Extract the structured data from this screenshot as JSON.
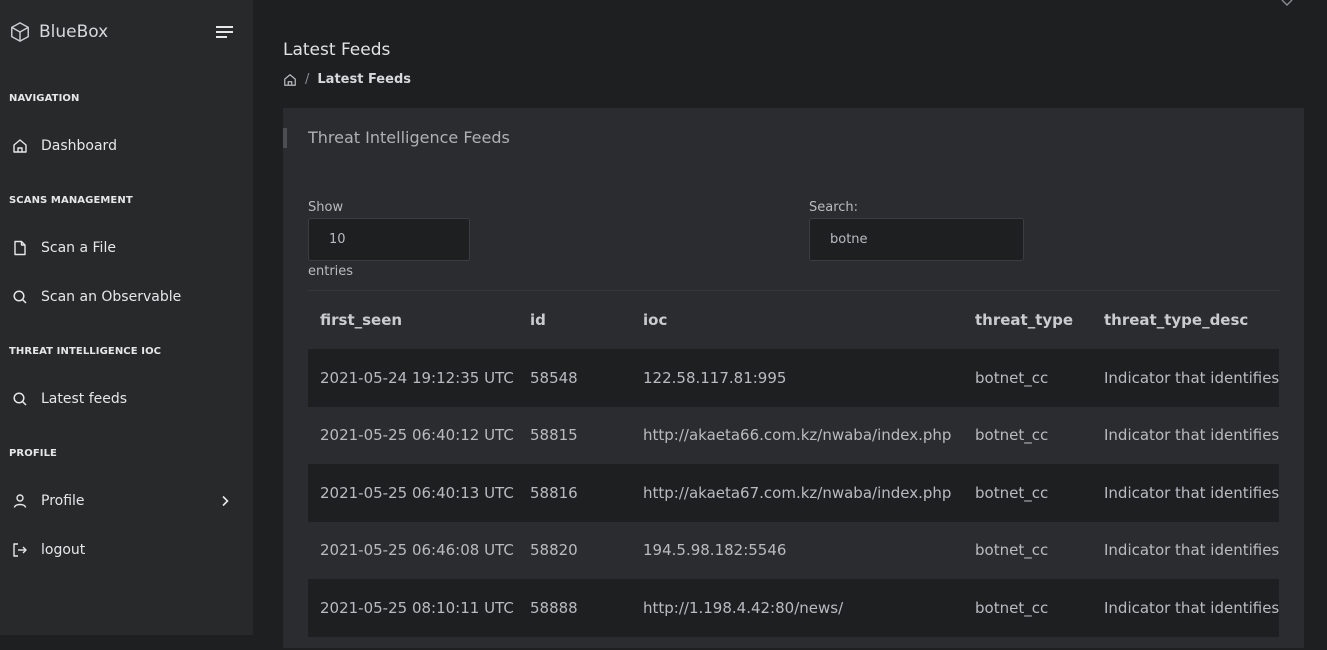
{
  "app": {
    "name": "BlueBox"
  },
  "sidebar": {
    "sections": [
      {
        "title": "NAVIGATION",
        "items": [
          {
            "label": "Dashboard",
            "icon": "home-icon"
          }
        ]
      },
      {
        "title": "SCANS MANAGEMENT",
        "items": [
          {
            "label": "Scan a File",
            "icon": "file-icon"
          },
          {
            "label": "Scan an Observable",
            "icon": "search-icon"
          }
        ]
      },
      {
        "title": "THREAT INTELLIGENCE IOC",
        "items": [
          {
            "label": "Latest feeds",
            "icon": "search-icon"
          }
        ]
      },
      {
        "title": "PROFILE",
        "items": [
          {
            "label": "Profile",
            "icon": "user-icon"
          },
          {
            "label": "logout",
            "icon": "logout-icon"
          }
        ]
      }
    ]
  },
  "page": {
    "title": "Latest Feeds",
    "breadcrumb_current": "Latest Feeds"
  },
  "card": {
    "title": "Threat Intelligence Feeds",
    "show_label": "Show",
    "show_value": "10",
    "entries_label": "entries",
    "search_label": "Search:",
    "search_value": "botne"
  },
  "table": {
    "columns": [
      "first_seen",
      "id",
      "ioc",
      "threat_type",
      "threat_type_desc"
    ],
    "rows": [
      [
        "2021-05-24 19:12:35 UTC",
        "58548",
        "122.58.117.81:995",
        "botnet_cc",
        "Indicator that identifies"
      ],
      [
        "2021-05-25 06:40:12 UTC",
        "58815",
        "http://akaeta66.com.kz/nwaba/index.php",
        "botnet_cc",
        "Indicator that identifies"
      ],
      [
        "2021-05-25 06:40:13 UTC",
        "58816",
        "http://akaeta67.com.kz/nwaba/index.php",
        "botnet_cc",
        "Indicator that identifies"
      ],
      [
        "2021-05-25 06:46:08 UTC",
        "58820",
        "194.5.98.182:5546",
        "botnet_cc",
        "Indicator that identifies"
      ],
      [
        "2021-05-25 08:10:11 UTC",
        "58888",
        "http://1.198.4.42:80/news/",
        "botnet_cc",
        "Indicator that identifies"
      ]
    ]
  }
}
